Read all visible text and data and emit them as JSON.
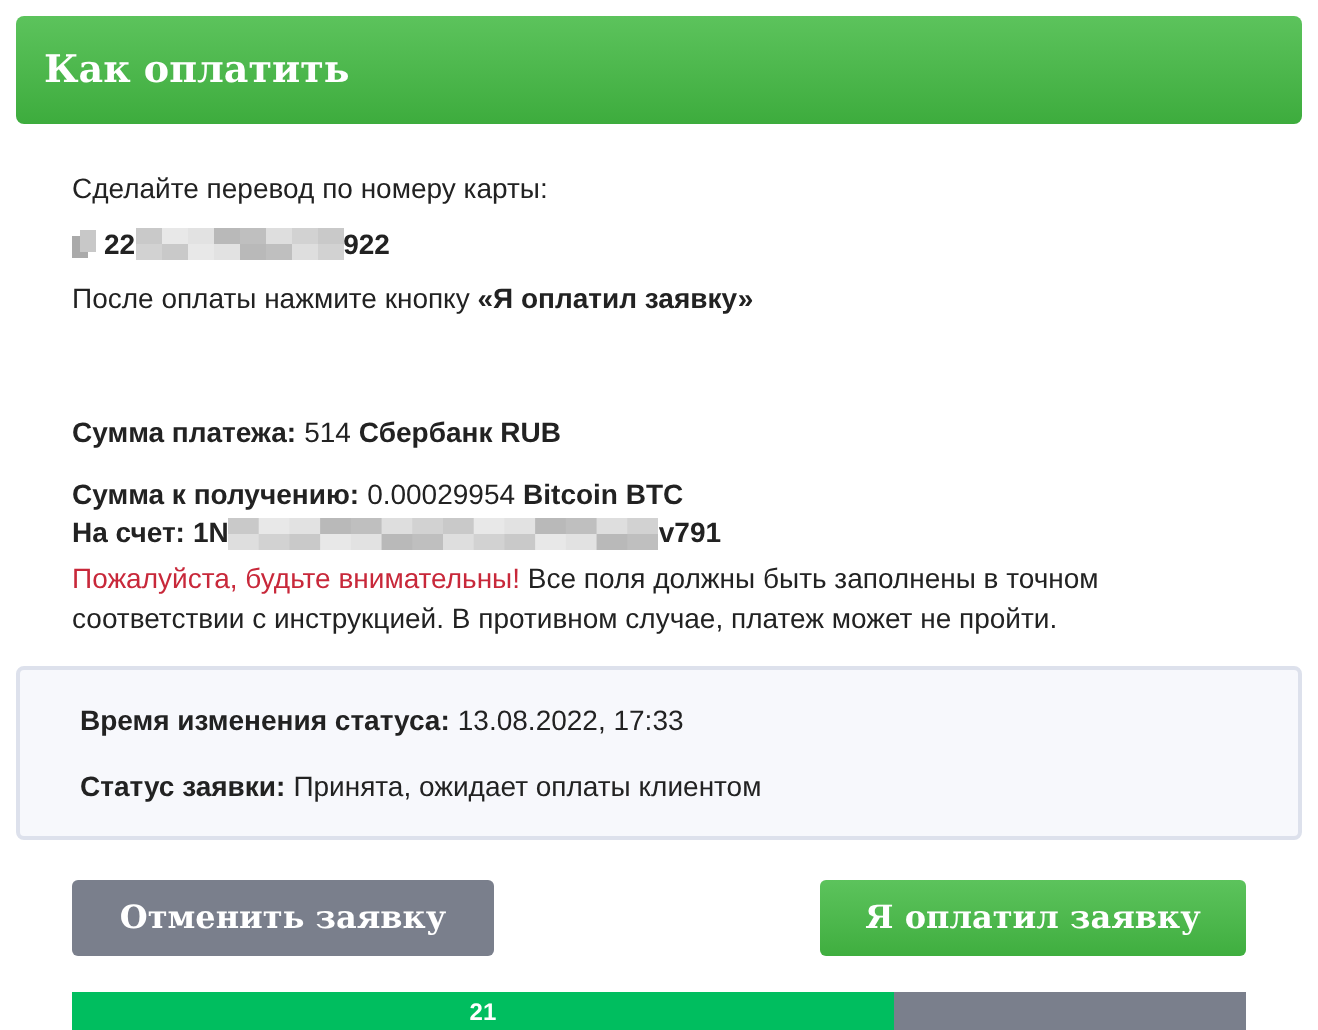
{
  "header": {
    "title": "Как оплатить"
  },
  "transfer": {
    "instruction": "Сделайте перевод по номеру карты:",
    "card_number_start": "22",
    "card_number_end": "922",
    "after_payment": "После оплаты нажмите кнопку **«Я оплатил заявку»**"
  },
  "payment": {
    "amount_label": "Сумма платежа:",
    "amount_value": "514",
    "amount_currency": "Сбербанк RUB"
  },
  "receive": {
    "amount_label": "Сумма к получению:",
    "amount_value": "0.00029954",
    "amount_currency": "Bitcoin BTC",
    "account_label": "На счет:",
    "account_start": "1N",
    "account_end": "v791"
  },
  "warning": {
    "emphasis": "Пожалуйста, будьте внимательны!",
    "text": "Все поля должны быть заполнены в точном соответствии с инструкцией. В противном случае, платеж может не пройти."
  },
  "status_box": {
    "rows": [
      {
        "label": "Время изменения статуса:",
        "value": "13.08.2022, 17:33"
      },
      {
        "label": "Статус заявки:",
        "value": "Принята, ожидает оплаты клиентом"
      }
    ]
  },
  "buttons": [
    {
      "kind": "cancel",
      "label": "Отменить заявку"
    },
    {
      "kind": "confirm",
      "label": "Я оплатил заявку"
    }
  ],
  "progress": {
    "label": "21",
    "level": 0.7
  }
}
